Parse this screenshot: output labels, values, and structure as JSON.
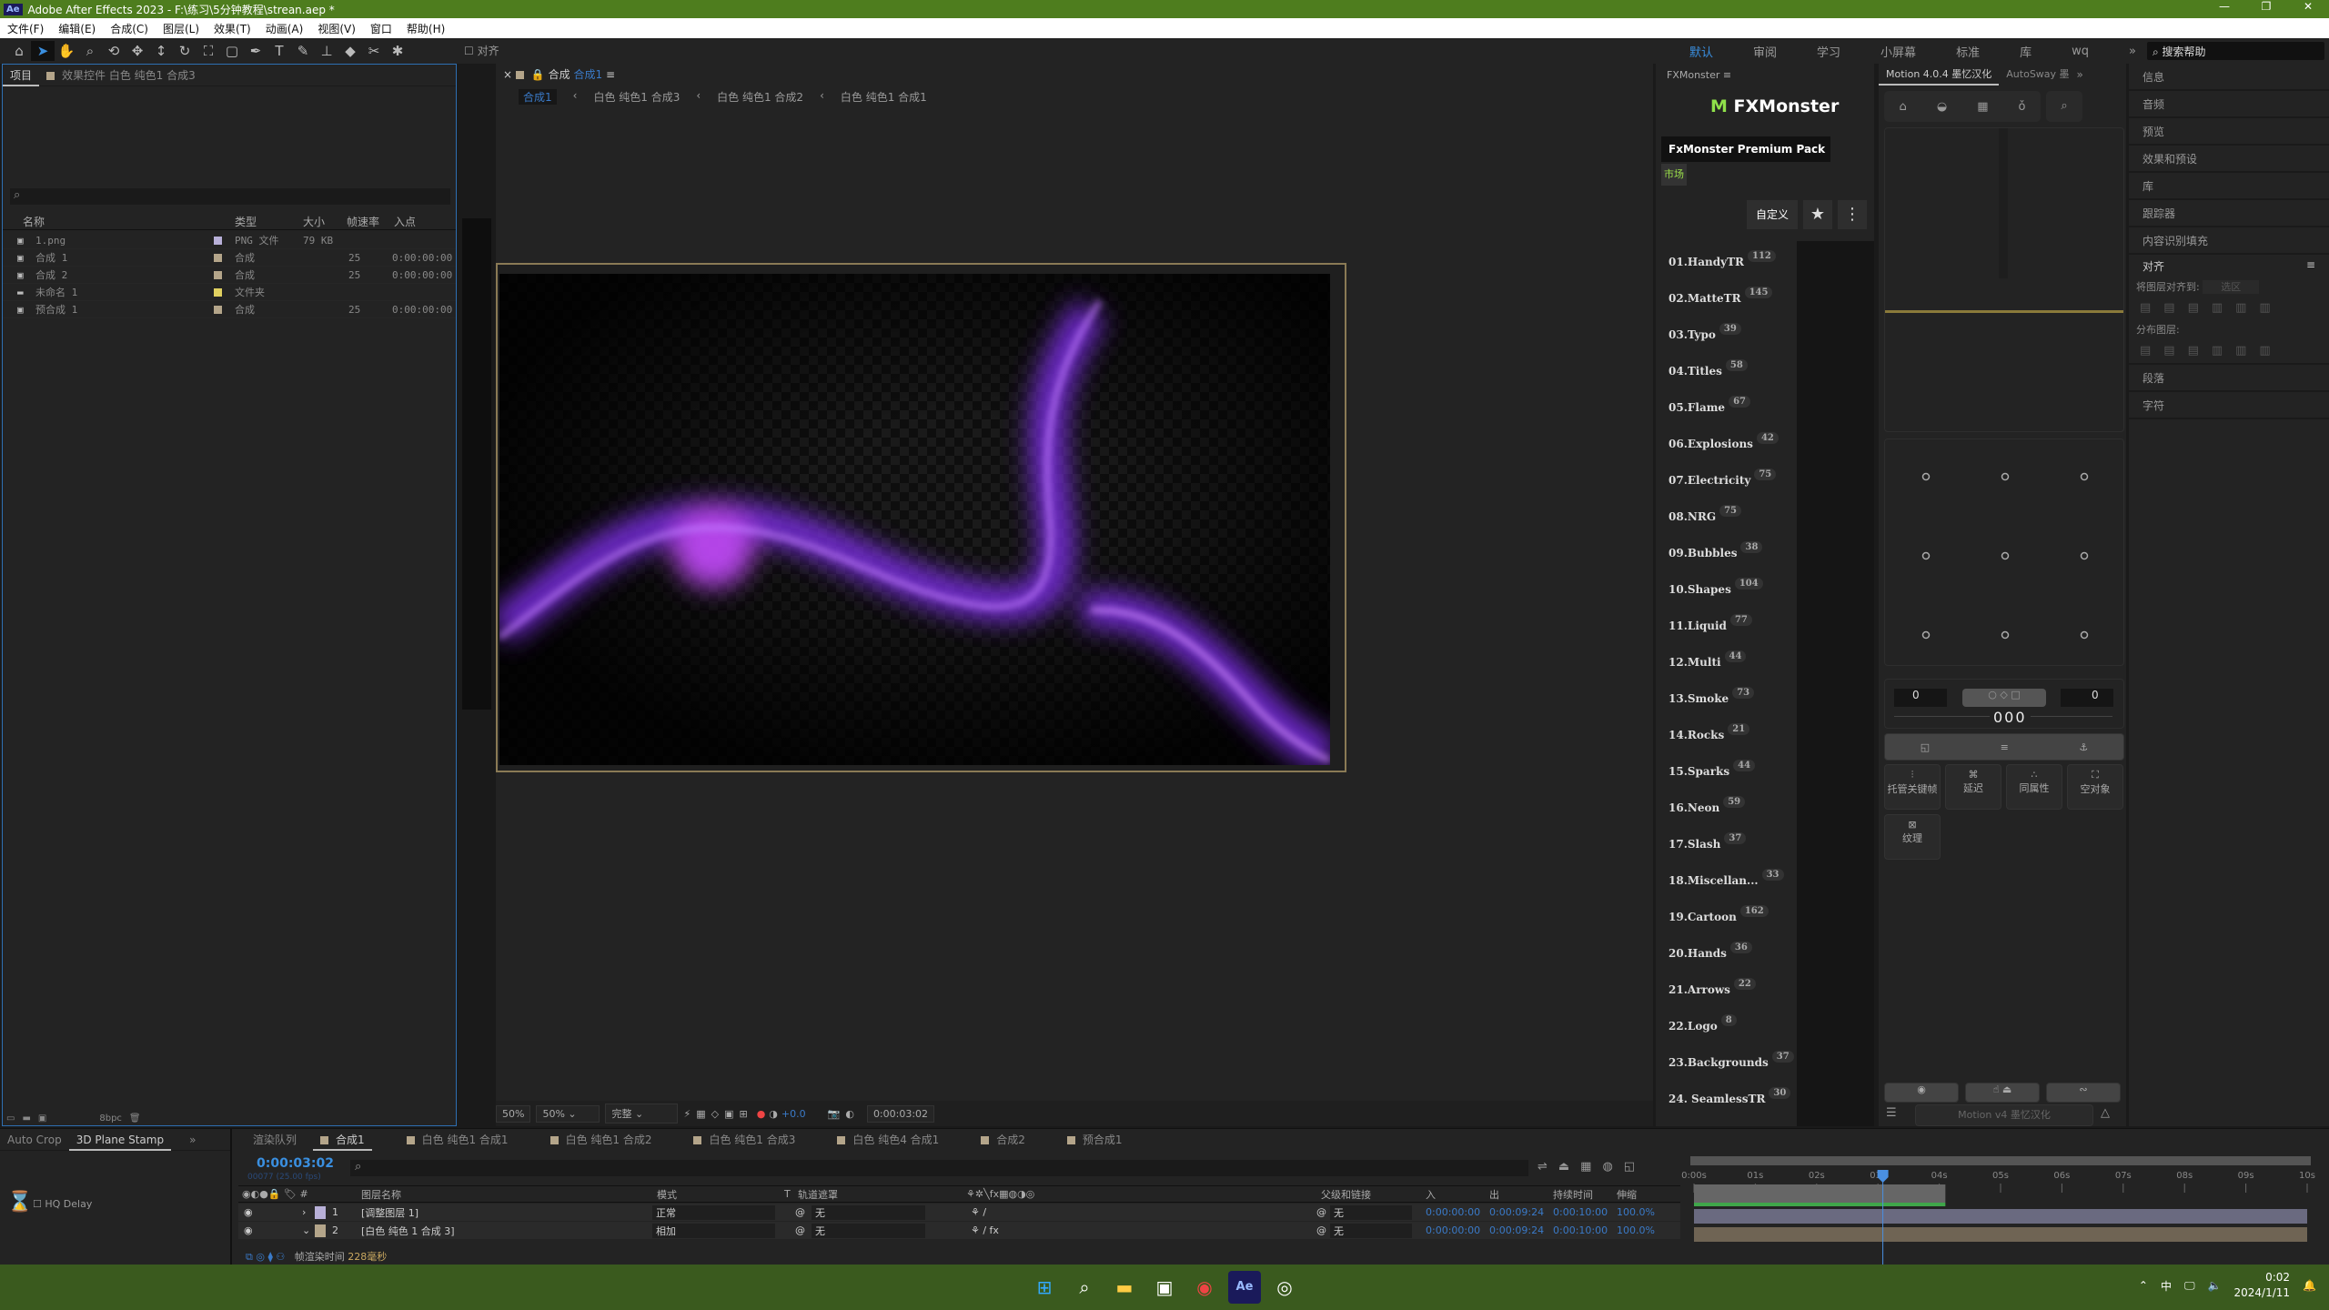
{
  "window": {
    "title": "Adobe After Effects 2023 - F:\\练习\\5分钟教程\\strean.aep *",
    "app_badge": "Ae",
    "controls": [
      "—",
      "❐",
      "✕"
    ]
  },
  "menu": [
    "文件(F)",
    "编辑(E)",
    "合成(C)",
    "图层(L)",
    "效果(T)",
    "动画(A)",
    "视图(V)",
    "窗口",
    "帮助(H)"
  ],
  "toolbar": {
    "snap_label": "对齐",
    "workspaces": [
      "默认",
      "审阅",
      "学习",
      "小屏幕",
      "标准",
      "库",
      "wq"
    ],
    "active_workspace": "默认",
    "search_placeholder": "搜索帮助"
  },
  "project": {
    "tab": "项目",
    "effects_tab": "效果控件 白色 纯色1 合成3",
    "columns": [
      "名称",
      "类型",
      "大小",
      "帧速率",
      "入点"
    ],
    "items": [
      {
        "name": "1.png",
        "type": "PNG 文件",
        "size": "79 KB",
        "fps": "",
        "in": "",
        "color": "#b8b0d8"
      },
      {
        "name": "合成 1",
        "type": "合成",
        "size": "",
        "fps": "25",
        "in": "0:00:00:00",
        "color": "#b4a58a"
      },
      {
        "name": "合成 2",
        "type": "合成",
        "size": "",
        "fps": "25",
        "in": "0:00:00:00",
        "color": "#b4a58a"
      },
      {
        "name": "未命名 1",
        "type": "文件夹",
        "size": "",
        "fps": "",
        "in": "",
        "color": "#e0d060"
      },
      {
        "name": "预合成 1",
        "type": "合成",
        "size": "",
        "fps": "25",
        "in": "0:00:00:00",
        "color": "#b4a58a"
      }
    ],
    "bpc": "8bpc"
  },
  "viewer": {
    "tab_prefix": "合成",
    "tab_name": "合成1",
    "breadcrumbs": [
      "合成1",
      "白色 纯色1 合成3",
      "白色 纯色1 合成2",
      "白色 纯色1 合成1"
    ],
    "zoom": "50%",
    "zoom_select": "50%",
    "resolution": "完整",
    "exposure": "+0.0",
    "timecode": "0:00:03:02"
  },
  "fxmonster": {
    "panel_title": "FXMonster",
    "logo": "FXMonster",
    "pack": "FxMonster Premium Pack",
    "market": "市场",
    "custom": "自定义",
    "categories": [
      {
        "name": "01.HandyTR",
        "count": "112"
      },
      {
        "name": "02.MatteTR",
        "count": "145"
      },
      {
        "name": "03.Typo",
        "count": "39"
      },
      {
        "name": "04.Titles",
        "count": "58"
      },
      {
        "name": "05.Flame",
        "count": "67"
      },
      {
        "name": "06.Explosions",
        "count": "42"
      },
      {
        "name": "07.Electricity",
        "count": "75"
      },
      {
        "name": "08.NRG",
        "count": "75"
      },
      {
        "name": "09.Bubbles",
        "count": "38"
      },
      {
        "name": "10.Shapes",
        "count": "104"
      },
      {
        "name": "11.Liquid",
        "count": "77"
      },
      {
        "name": "12.Multi",
        "count": "44"
      },
      {
        "name": "13.Smoke",
        "count": "73"
      },
      {
        "name": "14.Rocks",
        "count": "21"
      },
      {
        "name": "15.Sparks",
        "count": "44"
      },
      {
        "name": "16.Neon",
        "count": "59"
      },
      {
        "name": "17.Slash",
        "count": "37"
      },
      {
        "name": "18.Miscellan...",
        "count": "33"
      },
      {
        "name": "19.Cartoon",
        "count": "162"
      },
      {
        "name": "20.Hands",
        "count": "36"
      },
      {
        "name": "21.Arrows",
        "count": "22"
      },
      {
        "name": "22.Logo",
        "count": "8"
      },
      {
        "name": "23.Backgrounds",
        "count": "37"
      },
      {
        "name": "24. SeamlessTR",
        "count": "30"
      }
    ]
  },
  "motion": {
    "tab": "Motion 4.0.4 墨忆汉化",
    "tab2": "AutoSway 墨",
    "left_val": "0",
    "right_val": "0",
    "readout": "000",
    "tools": [
      "托管关键帧",
      "延迟",
      "同属性",
      "空对象",
      "纹理"
    ],
    "footer": "Motion v4 墨忆汉化"
  },
  "right_panels": [
    "信息",
    "音频",
    "预览",
    "效果和预设",
    "库",
    "跟踪器",
    "内容识别填充"
  ],
  "align": {
    "title": "对齐",
    "align_to_label": "将图层对齐到:",
    "align_to_value": "选区",
    "distribute_label": "分布图层:",
    "after": [
      "段落",
      "字符"
    ]
  },
  "effects_panel": {
    "tabs": [
      "Auto Crop",
      "3D Plane Stamp"
    ],
    "checkbox": "HQ Delay"
  },
  "timeline": {
    "tabs": [
      "渲染队列",
      "合成1",
      "白色 纯色1 合成1",
      "白色 纯色1 合成2",
      "白色 纯色1 合成3",
      "白色 纯色4 合成1",
      "合成2",
      "预合成1"
    ],
    "timecode": "0:00:03:02",
    "frame_info": "00077 (25.00 fps)",
    "columns": [
      "图层名称",
      "模式",
      "T",
      "轨道遮罩",
      "父级和链接",
      "入",
      "出",
      "持续时间",
      "伸缩"
    ],
    "layers": [
      {
        "num": "1",
        "name": "[调整图层 1]",
        "mode": "正常",
        "matte": "无",
        "parent": "无",
        "in": "0:00:00:00",
        "out": "0:00:09:24",
        "dur": "0:00:10:00",
        "stretch": "100.0%",
        "color": "#b8b0d8",
        "bar": "#6a6a80"
      },
      {
        "num": "2",
        "name": "[白色 纯色 1 合成 3]",
        "mode": "相加",
        "matte": "无",
        "parent": "无",
        "in": "0:00:00:00",
        "out": "0:00:09:24",
        "dur": "0:00:10:00",
        "stretch": "100.0%",
        "color": "#b4a58a",
        "bar": "#6f6454"
      }
    ],
    "ruler": [
      "0:00s",
      "01s",
      "02s",
      "03s",
      "04s",
      "05s",
      "06s",
      "07s",
      "08s",
      "09s",
      "10s"
    ],
    "playhead_seconds": 3.08,
    "work_area_end_seconds": 4.1,
    "render_time_label": "帧渲染时间",
    "render_time": "228毫秒"
  },
  "taskbar": {
    "time": "0:02",
    "date": "2024/1/11",
    "ime": "中"
  }
}
